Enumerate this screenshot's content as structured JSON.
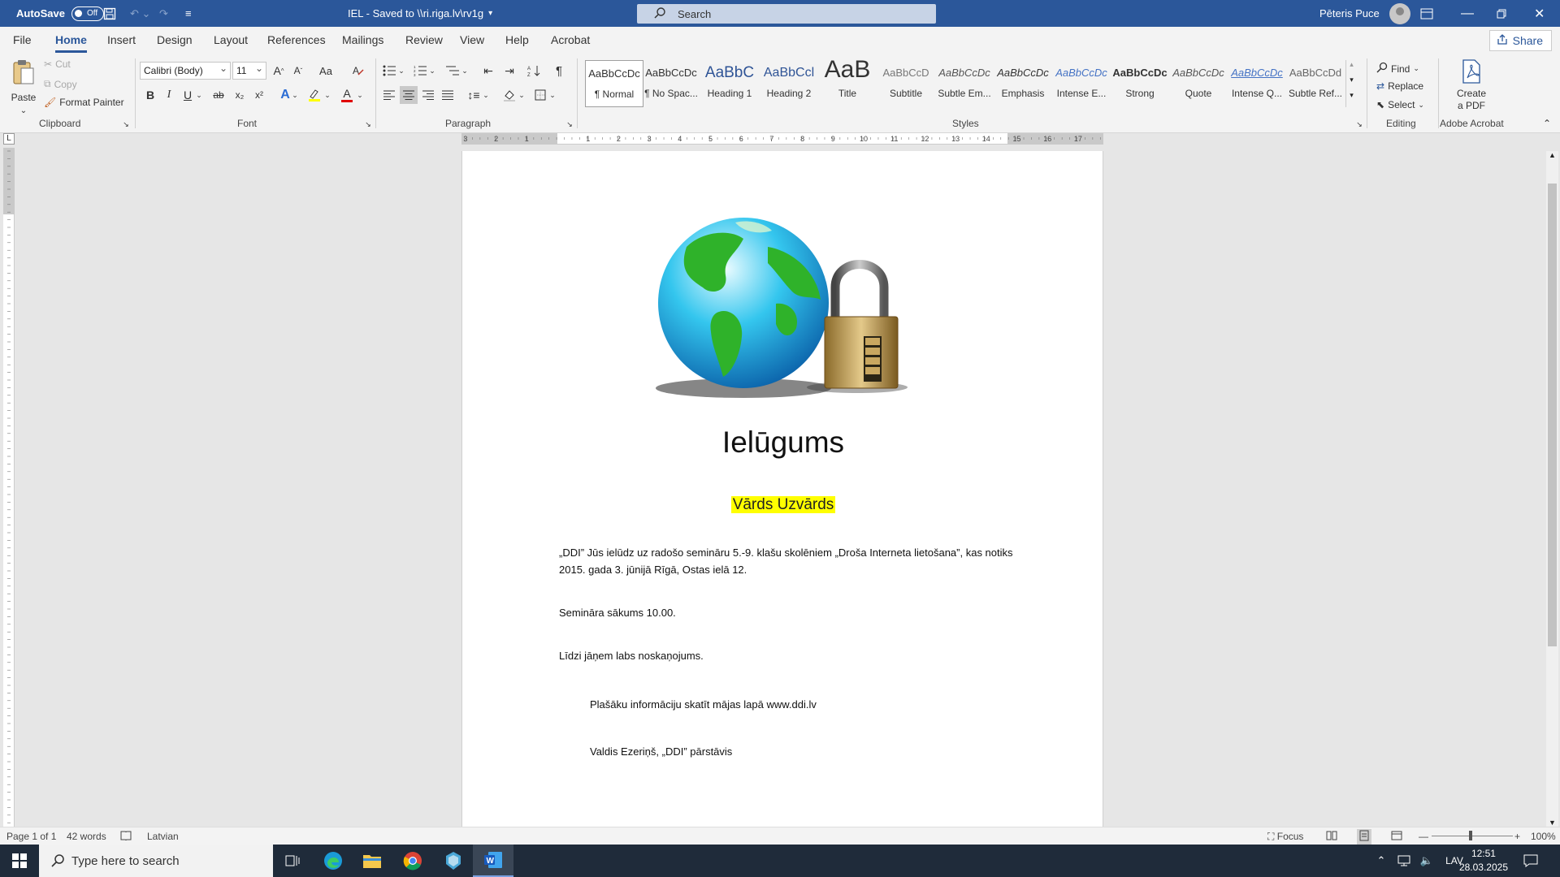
{
  "titlebar": {
    "autosave_label": "AutoSave",
    "autosave_state": "Off",
    "doc_title": "IEL  -  Saved to \\\\ri.riga.lv\\rv1g",
    "search_placeholder": "Search",
    "user_name": "Pēteris Puce"
  },
  "tabs": [
    "File",
    "Home",
    "Insert",
    "Design",
    "Layout",
    "References",
    "Mailings",
    "Review",
    "View",
    "Help",
    "Acrobat"
  ],
  "active_tab": "Home",
  "share_label": "Share",
  "ribbon": {
    "clipboard": {
      "paste": "Paste",
      "cut": "Cut",
      "copy": "Copy",
      "format_painter": "Format Painter",
      "label": "Clipboard"
    },
    "font": {
      "family": "Calibri (Body)",
      "size": "11",
      "label": "Font",
      "bold": "B",
      "italic": "I",
      "underline": "U",
      "strike": "ab",
      "sub": "x₂",
      "sup": "x²",
      "grow": "A^",
      "shrink": "Aˇ",
      "case": "Aa",
      "text_effects": "A",
      "font_color": "A"
    },
    "paragraph": {
      "label": "Paragraph"
    },
    "styles": {
      "label": "Styles",
      "items": [
        {
          "preview": "AaBbCcDc",
          "name": "¶ Normal"
        },
        {
          "preview": "AaBbCcDc",
          "name": "¶ No Spac..."
        },
        {
          "preview": "AaBbC",
          "name": "Heading 1"
        },
        {
          "preview": "AaBbCcl",
          "name": "Heading 2"
        },
        {
          "preview": "AaB",
          "name": "Title"
        },
        {
          "preview": "AaBbCcD",
          "name": "Subtitle"
        },
        {
          "preview": "AaBbCcDc",
          "name": "Subtle Em..."
        },
        {
          "preview": "AaBbCcDc",
          "name": "Emphasis"
        },
        {
          "preview": "AaBbCcDc",
          "name": "Intense E..."
        },
        {
          "preview": "AaBbCcDc",
          "name": "Strong"
        },
        {
          "preview": "AaBbCcDc",
          "name": "Quote"
        },
        {
          "preview": "AaBbCcDc",
          "name": "Intense Q..."
        },
        {
          "preview": "AaBbCcDd",
          "name": "Subtle Ref..."
        }
      ]
    },
    "editing": {
      "label": "Editing",
      "find": "Find",
      "replace": "Replace",
      "select": "Select"
    },
    "acrobat": {
      "label": "Adobe Acrobat",
      "create_line1": "Create",
      "create_line2": "a PDF"
    }
  },
  "ruler_numbers": [
    "3",
    "2",
    "1",
    "1",
    "2",
    "3",
    "4",
    "5",
    "6",
    "7",
    "8",
    "9",
    "10",
    "11",
    "12",
    "13",
    "14",
    "15",
    "16",
    "17"
  ],
  "document": {
    "title": "Ielūgums",
    "name_field": "Vārds Uzvārds",
    "para1": "„DDI” Jūs ielūdz uz radošo semināru 5.-9. klašu skolēniem „Droša Interneta lietošana”, kas notiks 2015. gada 3. jūnijā Rīgā, Ostas ielā 12.",
    "para2": "Semināra sākums 10.00.",
    "para3": "Līdzi jāņem labs noskaņojums.",
    "para4": "Plašāku informāciju skatīt mājas lapā www.ddi.lv",
    "para5": "Valdis Ezeriņš, „DDI” pārstāvis"
  },
  "statusbar": {
    "page": "Page 1 of 1",
    "words": "42 words",
    "language": "Latvian",
    "focus": "Focus",
    "zoom": "100%"
  },
  "taskbar": {
    "search_placeholder": "Type here to search",
    "lang": "LAV",
    "time": "12:51",
    "date": "28.03.2025"
  }
}
